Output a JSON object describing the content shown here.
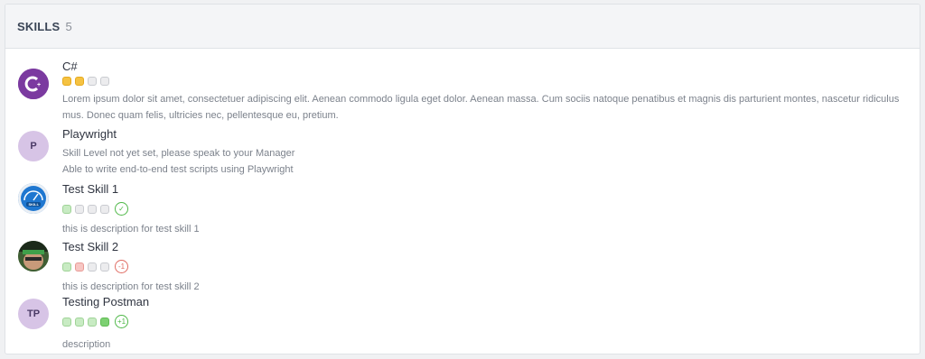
{
  "header": {
    "title": "SKILLS",
    "count": "5"
  },
  "skills": [
    {
      "name": "C#",
      "levels": [
        "yellow",
        "yellow",
        "grey",
        "grey"
      ],
      "description": "Lorem ipsum dolor sit amet, consectetuer adipiscing elit. Aenean commodo ligula eget dolor. Aenean massa. Cum sociis natoque penatibus et magnis dis parturient montes, nascetur ridiculus mus. Donec quam felis, ultricies nec, pellentesque eu, pretium.",
      "avatar_icon": "csharp-logo-icon"
    },
    {
      "name": "Playwright",
      "avatar_initials": "P",
      "level_note": "Skill Level not yet set, please speak to your Manager",
      "description": "Able to write end-to-end test scripts using Playwright"
    },
    {
      "name": "Test Skill 1",
      "levels": [
        "green",
        "grey",
        "grey",
        "grey"
      ],
      "badge": "✓",
      "badge_type": "check",
      "description": "this is description for test skill 1",
      "avatar_icon": "skill-gauge-icon"
    },
    {
      "name": "Test Skill 2",
      "levels": [
        "green",
        "red",
        "grey",
        "grey"
      ],
      "badge": "-1",
      "badge_type": "neg",
      "description": "this is description for test skill 2",
      "avatar_icon": "profile-photo"
    },
    {
      "name": "Testing Postman",
      "avatar_initials": "TP",
      "levels": [
        "green",
        "green",
        "green",
        "green-strong"
      ],
      "badge": "+1",
      "badge_type": "pos",
      "description": "description"
    }
  ]
}
